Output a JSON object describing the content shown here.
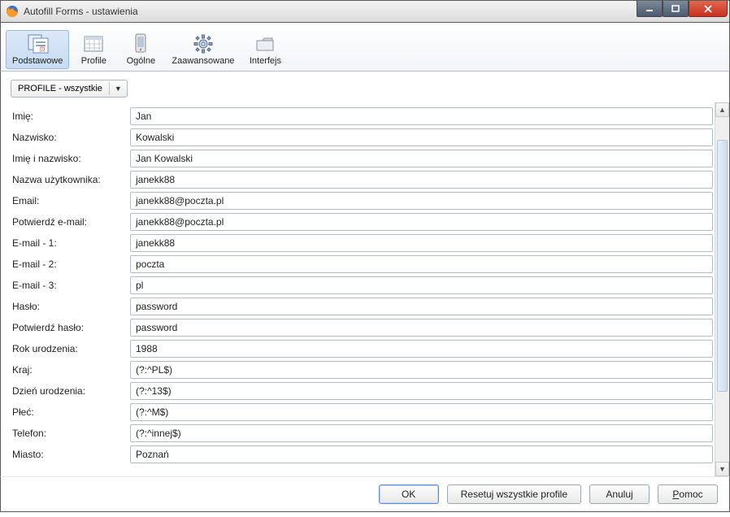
{
  "window": {
    "title": "Autofill Forms - ustawienia"
  },
  "toolbar": {
    "tabs": [
      {
        "label": "Podstawowe"
      },
      {
        "label": "Profile"
      },
      {
        "label": "Ogólne"
      },
      {
        "label": "Zaawansowane"
      },
      {
        "label": "Interfejs"
      }
    ]
  },
  "profileSelect": {
    "value": "PROFILE - wszystkie"
  },
  "fields": [
    {
      "label": "Imię:",
      "value": "Jan"
    },
    {
      "label": "Nazwisko:",
      "value": "Kowalski"
    },
    {
      "label": "Imię i nazwisko:",
      "value": "Jan Kowalski"
    },
    {
      "label": "Nazwa użytkownika:",
      "value": "janekk88"
    },
    {
      "label": "Email:",
      "value": "janekk88@poczta.pl"
    },
    {
      "label": "Potwierdź e-mail:",
      "value": "janekk88@poczta.pl"
    },
    {
      "label": "E-mail - 1:",
      "value": "janekk88"
    },
    {
      "label": "E-mail - 2:",
      "value": "poczta"
    },
    {
      "label": "E-mail - 3:",
      "value": "pl"
    },
    {
      "label": "Hasło:",
      "value": "password"
    },
    {
      "label": "Potwierdź hasło:",
      "value": "password"
    },
    {
      "label": "Rok urodzenia:",
      "value": "1988"
    },
    {
      "label": "Kraj:",
      "value": "(?:^PL$)"
    },
    {
      "label": "Dzień urodzenia:",
      "value": "(?:^13$)"
    },
    {
      "label": "Płeć:",
      "value": "(?:^M$)"
    },
    {
      "label": "Telefon:",
      "value": "(?:^innej$)"
    },
    {
      "label": "Miasto:",
      "value": "Poznań"
    }
  ],
  "buttons": {
    "ok": "OK",
    "reset": "Resetuj wszystkie profile",
    "cancel": "Anuluj",
    "help": "Pomoc"
  }
}
